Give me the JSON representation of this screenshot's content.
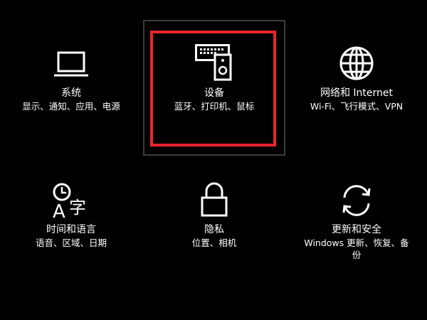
{
  "colors": {
    "background": "#000000",
    "text": "#ffffff",
    "highlight": "#e8252d",
    "hover_border": "#3c3c3c"
  },
  "tiles": [
    {
      "icon": "laptop-icon",
      "title": "系统",
      "desc": "显示、通知、应用、电源"
    },
    {
      "icon": "devices-icon",
      "title": "设备",
      "desc": "蓝牙、打印机、鼠标"
    },
    {
      "icon": "globe-icon",
      "title": "网络和 Internet",
      "desc": "Wi-Fi、飞行模式、VPN"
    },
    {
      "icon": "time-language-icon",
      "title": "时间和语言",
      "desc": "语音、区域、日期"
    },
    {
      "icon": "lock-icon",
      "title": "隐私",
      "desc": "位置、相机"
    },
    {
      "icon": "sync-icon",
      "title": "更新和安全",
      "desc_line1": "Windows 更新、恢复、备",
      "desc_line2": "份"
    }
  ],
  "time_language_icon_chars": {
    "a": "A",
    "zi": "字"
  }
}
